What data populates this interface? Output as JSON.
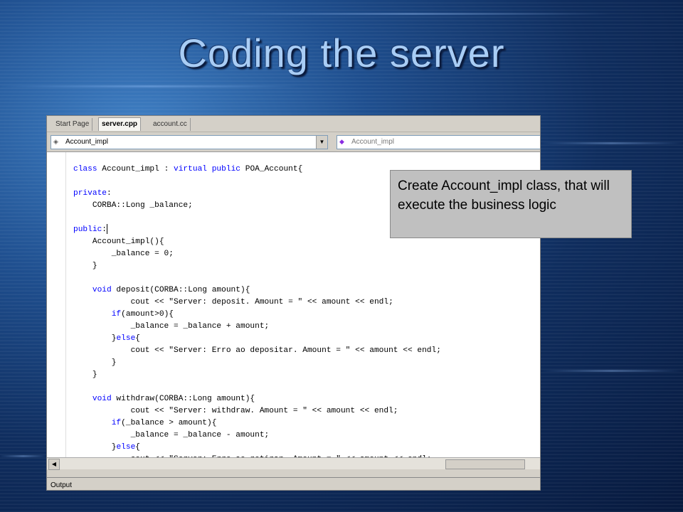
{
  "slide": {
    "title": "Coding the server"
  },
  "tabs": [
    {
      "label": "Start Page"
    },
    {
      "label": "server.cpp"
    },
    {
      "label": "account.cc"
    }
  ],
  "combos": {
    "class_value": "Account_impl",
    "member_value": "Account_impl"
  },
  "code_lines": [
    "class Account_impl : virtual public POA_Account{",
    "",
    "private:",
    "    CORBA::Long _balance;",
    "",
    "public:",
    "    Account_impl(){",
    "        _balance = 0;",
    "    }",
    "",
    "    void deposit(CORBA::Long amount){",
    "            cout << \"Server: deposit. Amount = \" << amount << endl;",
    "        if(amount>0){",
    "            _balance = _balance + amount;",
    "        }else{",
    "            cout << \"Server: Erro ao depositar. Amount = \" << amount << endl;",
    "        }",
    "    }",
    "",
    "    void withdraw(CORBA::Long amount){",
    "            cout << \"Server: withdraw. Amount = \" << amount << endl;",
    "        if(_balance > amount){",
    "            _balance = _balance - amount;",
    "        }else{",
    "            cout << \"Server: Erro ao retirar. Amount = \" << amount << endl;"
  ],
  "output": {
    "label": "Output"
  },
  "callout": {
    "text": "Create Account_impl class, that will execute the business logic"
  }
}
